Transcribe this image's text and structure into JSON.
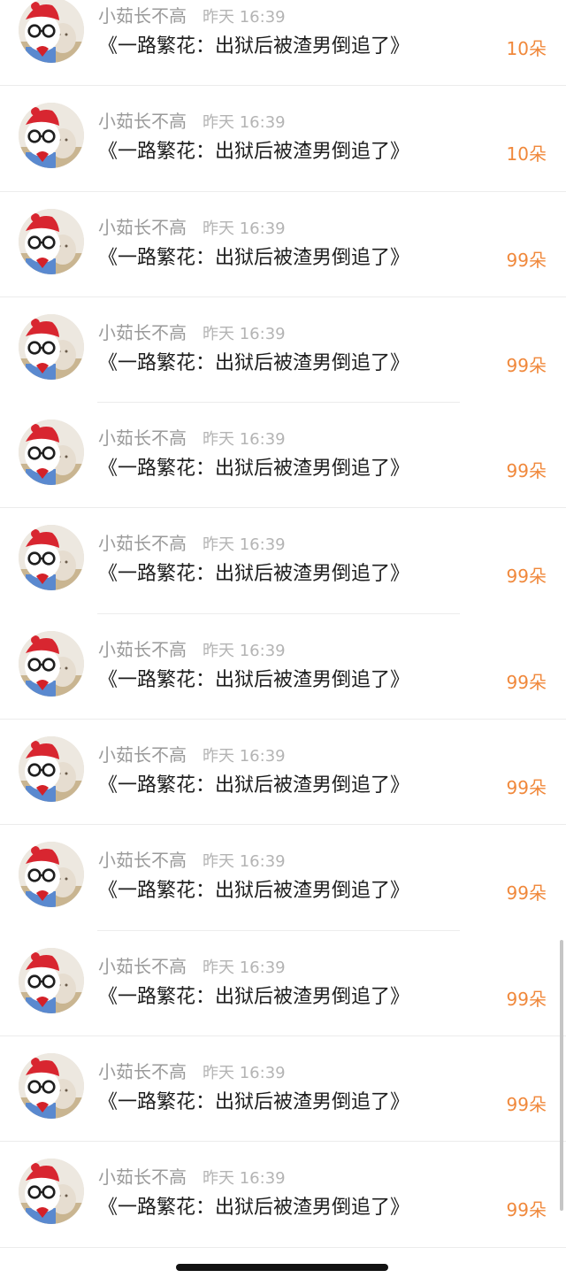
{
  "gift_list": {
    "rows": [
      {
        "name": "小茹长不高",
        "time": "昨天 16:39",
        "content": "《一路繁花：出狱后被渣男倒追了》",
        "flowers": "10朵",
        "divider": "full"
      },
      {
        "name": "小茹长不高",
        "time": "昨天 16:39",
        "content": "《一路繁花：出狱后被渣男倒追了》",
        "flowers": "10朵",
        "divider": "full"
      },
      {
        "name": "小茹长不高",
        "time": "昨天 16:39",
        "content": "《一路繁花：出狱后被渣男倒追了》",
        "flowers": "99朵",
        "divider": "full"
      },
      {
        "name": "小茹长不高",
        "time": "昨天 16:39",
        "content": "《一路繁花：出狱后被渣男倒追了》",
        "flowers": "99朵",
        "divider": "short"
      },
      {
        "name": "小茹长不高",
        "time": "昨天 16:39",
        "content": "《一路繁花：出狱后被渣男倒追了》",
        "flowers": "99朵",
        "divider": "full"
      },
      {
        "name": "小茹长不高",
        "time": "昨天 16:39",
        "content": "《一路繁花：出狱后被渣男倒追了》",
        "flowers": "99朵",
        "divider": "short"
      },
      {
        "name": "小茹长不高",
        "time": "昨天 16:39",
        "content": "《一路繁花：出狱后被渣男倒追了》",
        "flowers": "99朵",
        "divider": "full"
      },
      {
        "name": "小茹长不高",
        "time": "昨天 16:39",
        "content": "《一路繁花：出狱后被渣男倒追了》",
        "flowers": "99朵",
        "divider": "full"
      },
      {
        "name": "小茹长不高",
        "time": "昨天 16:39",
        "content": "《一路繁花：出狱后被渣男倒追了》",
        "flowers": "99朵",
        "divider": "short"
      },
      {
        "name": "小茹长不高",
        "time": "昨天 16:39",
        "content": "《一路繁花：出狱后被渣男倒追了》",
        "flowers": "99朵",
        "divider": "full"
      },
      {
        "name": "小茹长不高",
        "time": "昨天 16:39",
        "content": "《一路繁花：出狱后被渣男倒追了》",
        "flowers": "99朵",
        "divider": "full"
      },
      {
        "name": "小茹长不高",
        "time": "昨天 16:39",
        "content": "《一路繁花：出狱后被渣男倒追了》",
        "flowers": "99朵",
        "divider": "full"
      }
    ]
  },
  "colors": {
    "name_text": "#9a9a9a",
    "time_text": "#b4b4b4",
    "content_text": "#1d1d1d",
    "flowers_accent": "#f0883b",
    "divider": "#ececec"
  },
  "icons": {
    "avatar": "user-avatar"
  }
}
